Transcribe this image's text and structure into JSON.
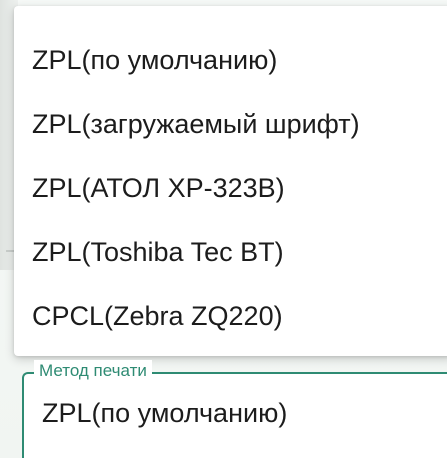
{
  "dropdown": {
    "options": [
      "ZPL(по умолчанию)",
      "ZPL(загружаемый шрифт)",
      "ZPL(АТОЛ XP-323B)",
      "ZPL(Toshiba Tec BT)",
      "CPCL(Zebra ZQ220)"
    ]
  },
  "print_method_field": {
    "label": "Метод печати",
    "value": "ZPL(по умолчанию)"
  },
  "colors": {
    "accent": "#2e8b73",
    "text": "#1c1c1c"
  }
}
